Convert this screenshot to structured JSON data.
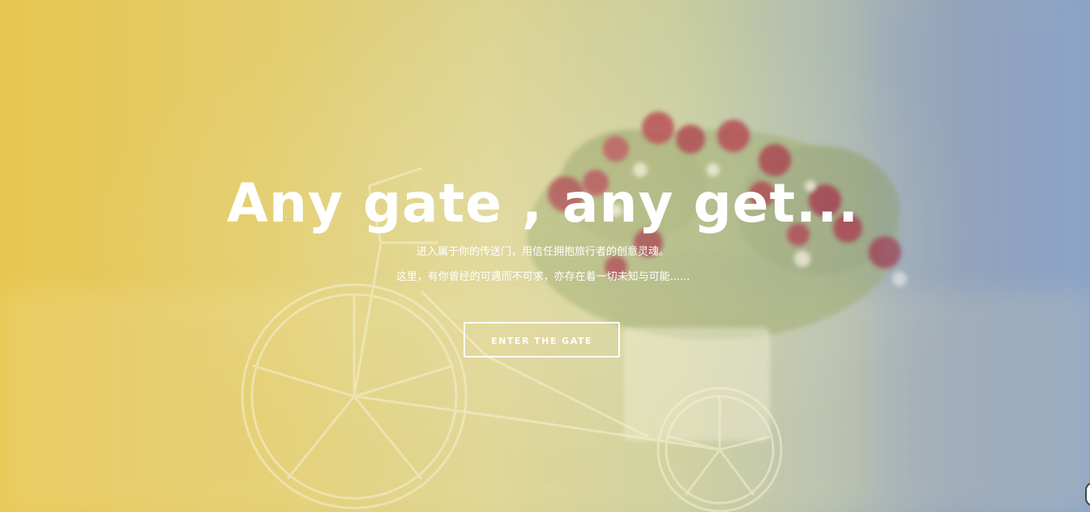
{
  "hero": {
    "title": "Any gate , any get...",
    "subtitle_line1": "进入属于你的传送门，用信任拥抱旅行者的创意灵魂。",
    "subtitle_line2": "这里，有你曾经的可遇而不可求，亦存在着一切未知与可能......",
    "cta_label": "ENTER THE GATE",
    "background_image": "flower-bicycle-photo"
  },
  "colors": {
    "gradient_left": "#e8c651",
    "gradient_middle": "#dcd392",
    "gradient_right": "#8aa4c8",
    "text": "#ffffff"
  }
}
